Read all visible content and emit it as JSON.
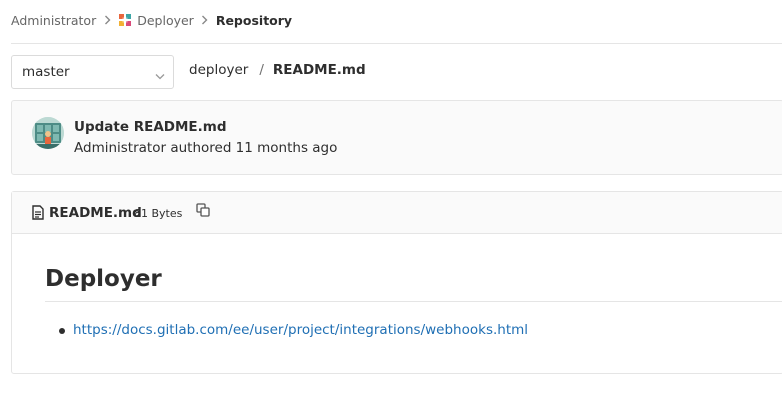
{
  "breadcrumb": {
    "items": [
      {
        "label": "Administrator"
      },
      {
        "label": "Deployer"
      },
      {
        "label": "Repository"
      }
    ]
  },
  "branch": {
    "selected": "master"
  },
  "path": {
    "project": "deployer",
    "separator": "/",
    "file": "README.md"
  },
  "commit": {
    "title": "Update README.md",
    "meta": "Administrator authored 11 months ago"
  },
  "file": {
    "name": "README.md",
    "size": "81 Bytes",
    "icon": "file-text-icon"
  },
  "readme": {
    "heading": "Deployer",
    "links": [
      "https://docs.gitlab.com/ee/user/project/integrations/webhooks.html"
    ]
  },
  "colors": {
    "link": "#1f6fb4",
    "text": "#2e2e2e",
    "muted": "#666666",
    "border": "#e5e5e5",
    "panel_bg": "#fafafa"
  }
}
